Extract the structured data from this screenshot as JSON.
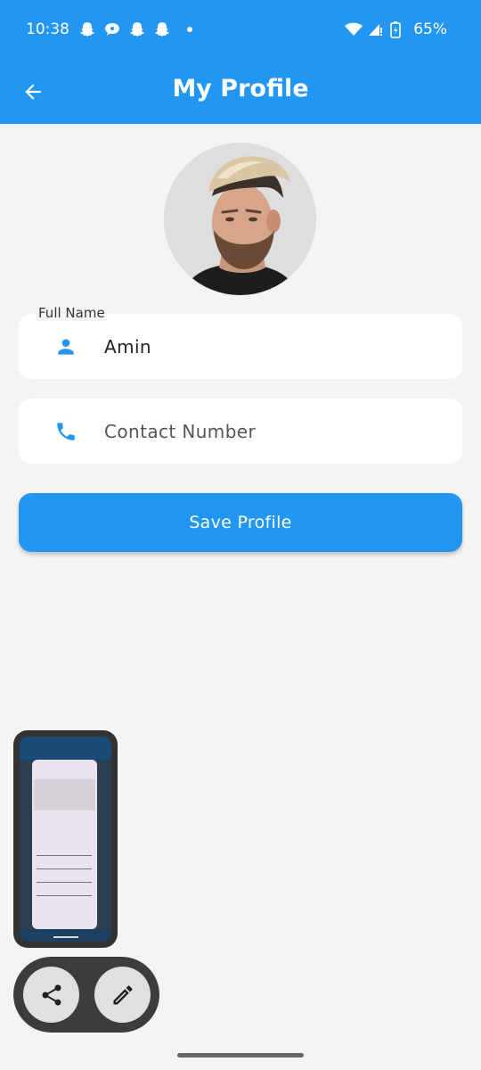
{
  "status_bar": {
    "time": "10:38",
    "battery": "65%",
    "icons": [
      "snapchat-icon",
      "chat-bubble-icon",
      "snapchat-icon",
      "snapchat-icon",
      "notification-dot",
      "wifi-icon",
      "signal-icon",
      "battery-charging-icon"
    ]
  },
  "app_bar": {
    "title": "My Profile",
    "back_icon": "arrow-back-icon"
  },
  "profile": {
    "avatar_alt": "profile photo"
  },
  "form": {
    "full_name_label": "Full Name",
    "full_name_value": "Amin",
    "full_name_icon": "person-icon",
    "contact_placeholder": "Contact Number",
    "contact_icon": "phone-icon",
    "save_label": "Save Profile"
  },
  "screenshot_preview": {
    "actions": [
      "share-icon",
      "edit-pencil-icon"
    ]
  },
  "colors": {
    "primary": "#2196f3",
    "background": "#f4f4f4",
    "field_bg": "#ffffff"
  }
}
